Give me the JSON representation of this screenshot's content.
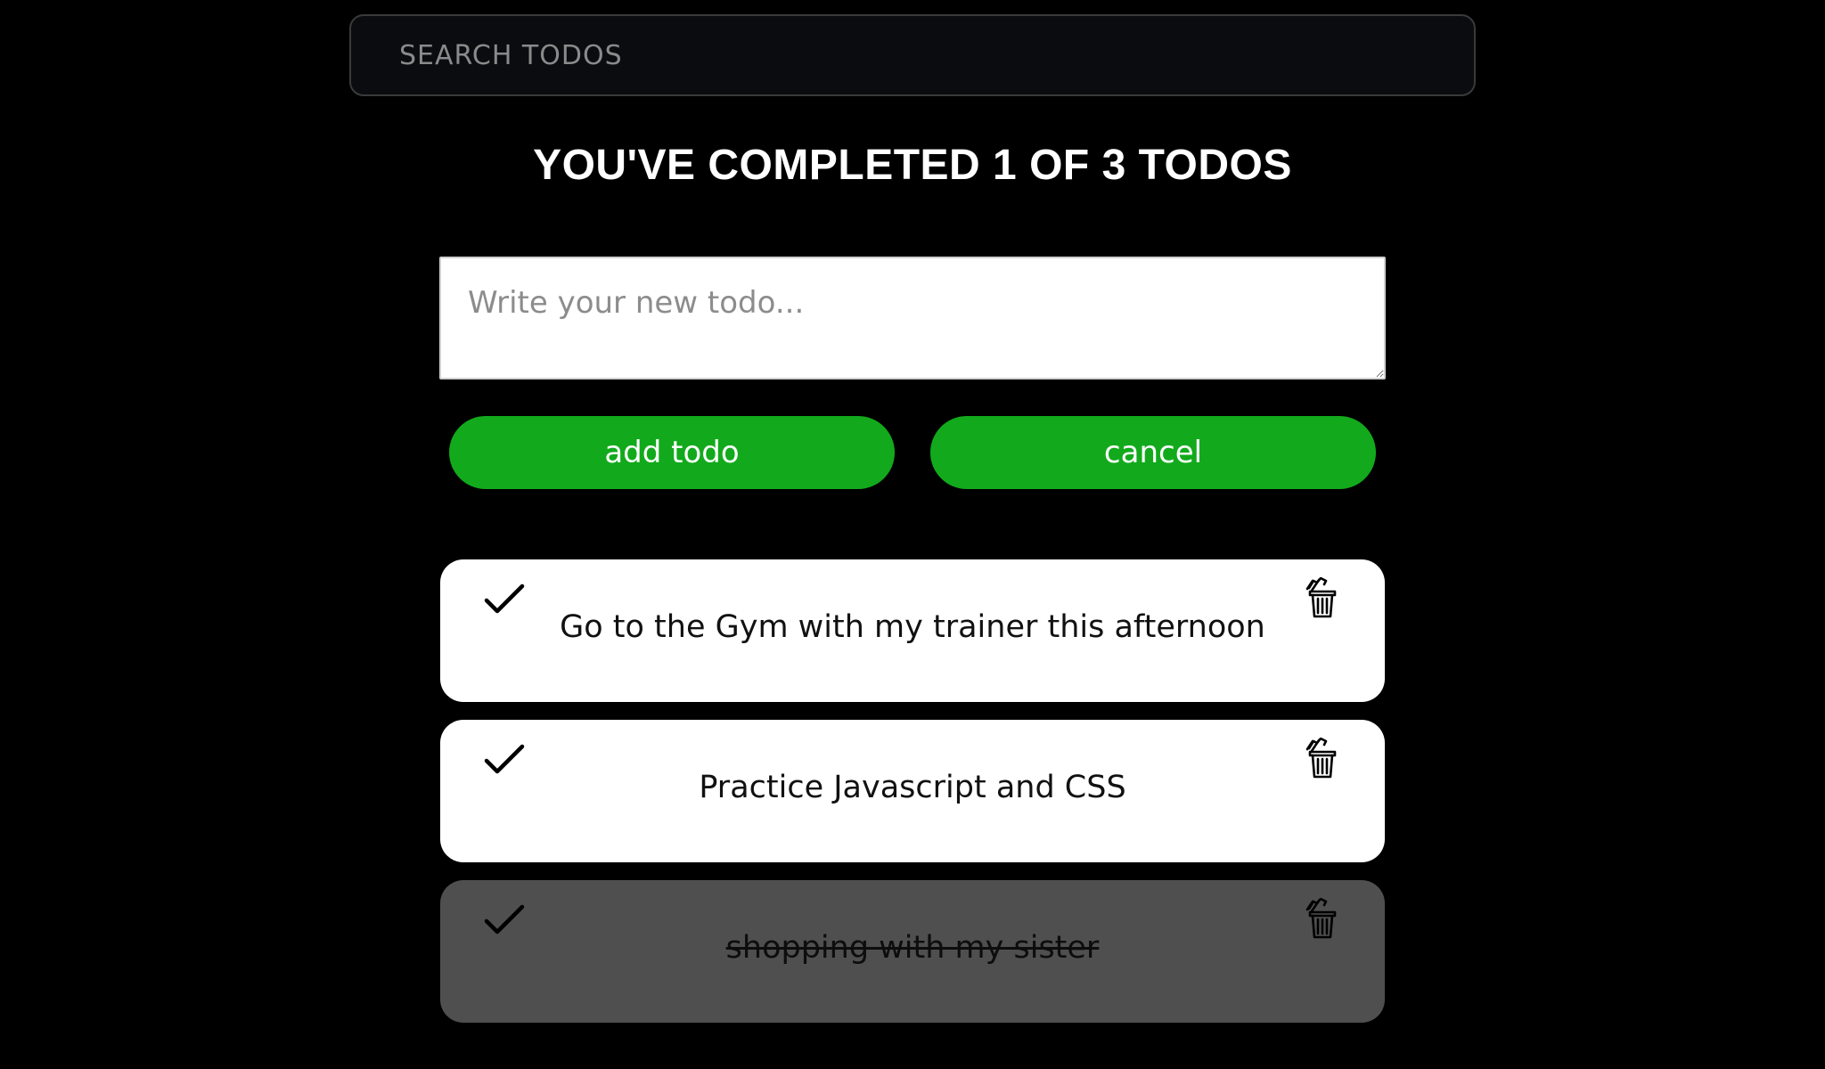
{
  "search": {
    "placeholder": "SEARCH TODOS"
  },
  "summary": {
    "title": "YOU'VE COMPLETED 1 OF 3 TODOS"
  },
  "new_todo": {
    "placeholder": "Write your new todo..."
  },
  "buttons": {
    "add_label": "add todo",
    "cancel_label": "cancel"
  },
  "todos": [
    {
      "text": "Go to the Gym with my trainer this afternoon",
      "completed": false
    },
    {
      "text": "Practice Javascript and CSS",
      "completed": false
    },
    {
      "text": "shopping with my sister",
      "completed": true
    }
  ],
  "colors": {
    "background": "#000000",
    "accent_green": "#12aa1c",
    "completed_item": "#4f4f4f",
    "item": "#ffffff"
  },
  "icons": {
    "check": "check-icon",
    "delete": "trash-icon"
  }
}
